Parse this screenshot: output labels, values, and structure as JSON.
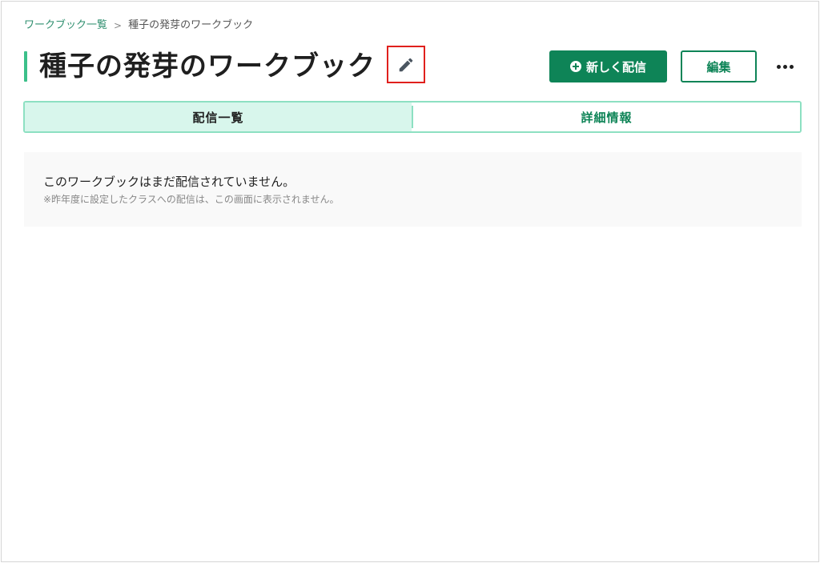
{
  "breadcrumb": {
    "parent": "ワークブック一覧",
    "separator": ">",
    "current": "種子の発芽のワークブック"
  },
  "header": {
    "title": "種子の発芽のワークブック",
    "edit_title_icon": "pencil-icon",
    "new_delivery_label": "新しく配信",
    "new_delivery_icon": "plus-circle-icon",
    "edit_label": "編集",
    "more_icon": "more-horizontal-icon"
  },
  "tabs": [
    {
      "label": "配信一覧",
      "active": true
    },
    {
      "label": "詳細情報",
      "active": false
    }
  ],
  "empty_state": {
    "message": "このワークブックはまだ配信されていません。",
    "note": "※昨年度に設定したクラスへの配信は、この画面に表示されません。"
  },
  "colors": {
    "accent": "#0e8457",
    "title_bar": "#3cc08a",
    "tab_active_bg": "#d8f6ec",
    "tab_border": "#8de0c2",
    "highlight_box": "#e0201d"
  }
}
